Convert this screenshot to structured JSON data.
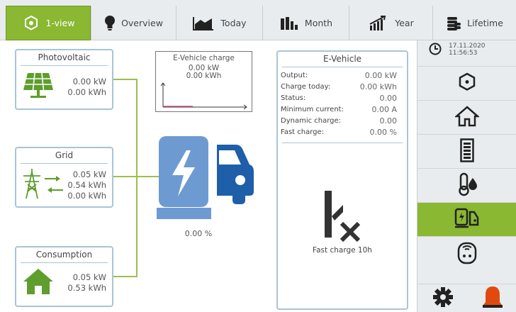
{
  "tabs": [
    {
      "label": "1-view",
      "icon": "hub-icon",
      "active": true
    },
    {
      "label": "Overview",
      "icon": "bulb-icon",
      "active": false
    },
    {
      "label": "Today",
      "icon": "area-chart-icon",
      "active": false
    },
    {
      "label": "Month",
      "icon": "bar-chart-icon",
      "active": false
    },
    {
      "label": "Year",
      "icon": "trend-chart-icon",
      "active": false
    },
    {
      "label": "Lifetime",
      "icon": "coins-icon",
      "active": false
    }
  ],
  "clock": {
    "date": "17.11.2020",
    "time": "11:56:53"
  },
  "sidebar": [
    "hub-icon",
    "house-icon",
    "battery-icon",
    "thermometer-drop-icon",
    "ev-charger-icon",
    "smart-plug-icon"
  ],
  "photovoltaic": {
    "title": "Photovoltaic",
    "power": "0.00 kW",
    "energy": "0.00 kWh"
  },
  "grid": {
    "title": "Grid",
    "power": "0.05 kW",
    "import": "0.54 kWh",
    "export": "0.00 kWh"
  },
  "consumption": {
    "title": "Consumption",
    "power": "0.05 kW",
    "energy": "0.53 kWh"
  },
  "ev_chart": {
    "title": "E-Vehicle charge",
    "power": "0.00 kW",
    "energy": "0.00 kWh"
  },
  "charger_percent": "0.00 %",
  "evehicle": {
    "title": "E-Vehicle",
    "rows": [
      {
        "label": "Output:",
        "value": "0.00 kW"
      },
      {
        "label": "Charge today:",
        "value": "0.00 kWh"
      },
      {
        "label": "Status:",
        "value": "0.00"
      },
      {
        "label": "Minimum current:",
        "value": "0.00 A"
      },
      {
        "label": "Dynamic charge:",
        "value": "0.00"
      },
      {
        "label": "Fast charge:",
        "value": "0.00 %"
      }
    ],
    "fast_charge_text": "Fast charge 10h"
  },
  "colors": {
    "accent": "#8ab833",
    "panel_border": "#a9c4d8",
    "flow_line": "#9cc04a",
    "charger_blue": "#6d9bd1",
    "car_blue": "#1f5ea8",
    "alarm": "#e04a10"
  }
}
